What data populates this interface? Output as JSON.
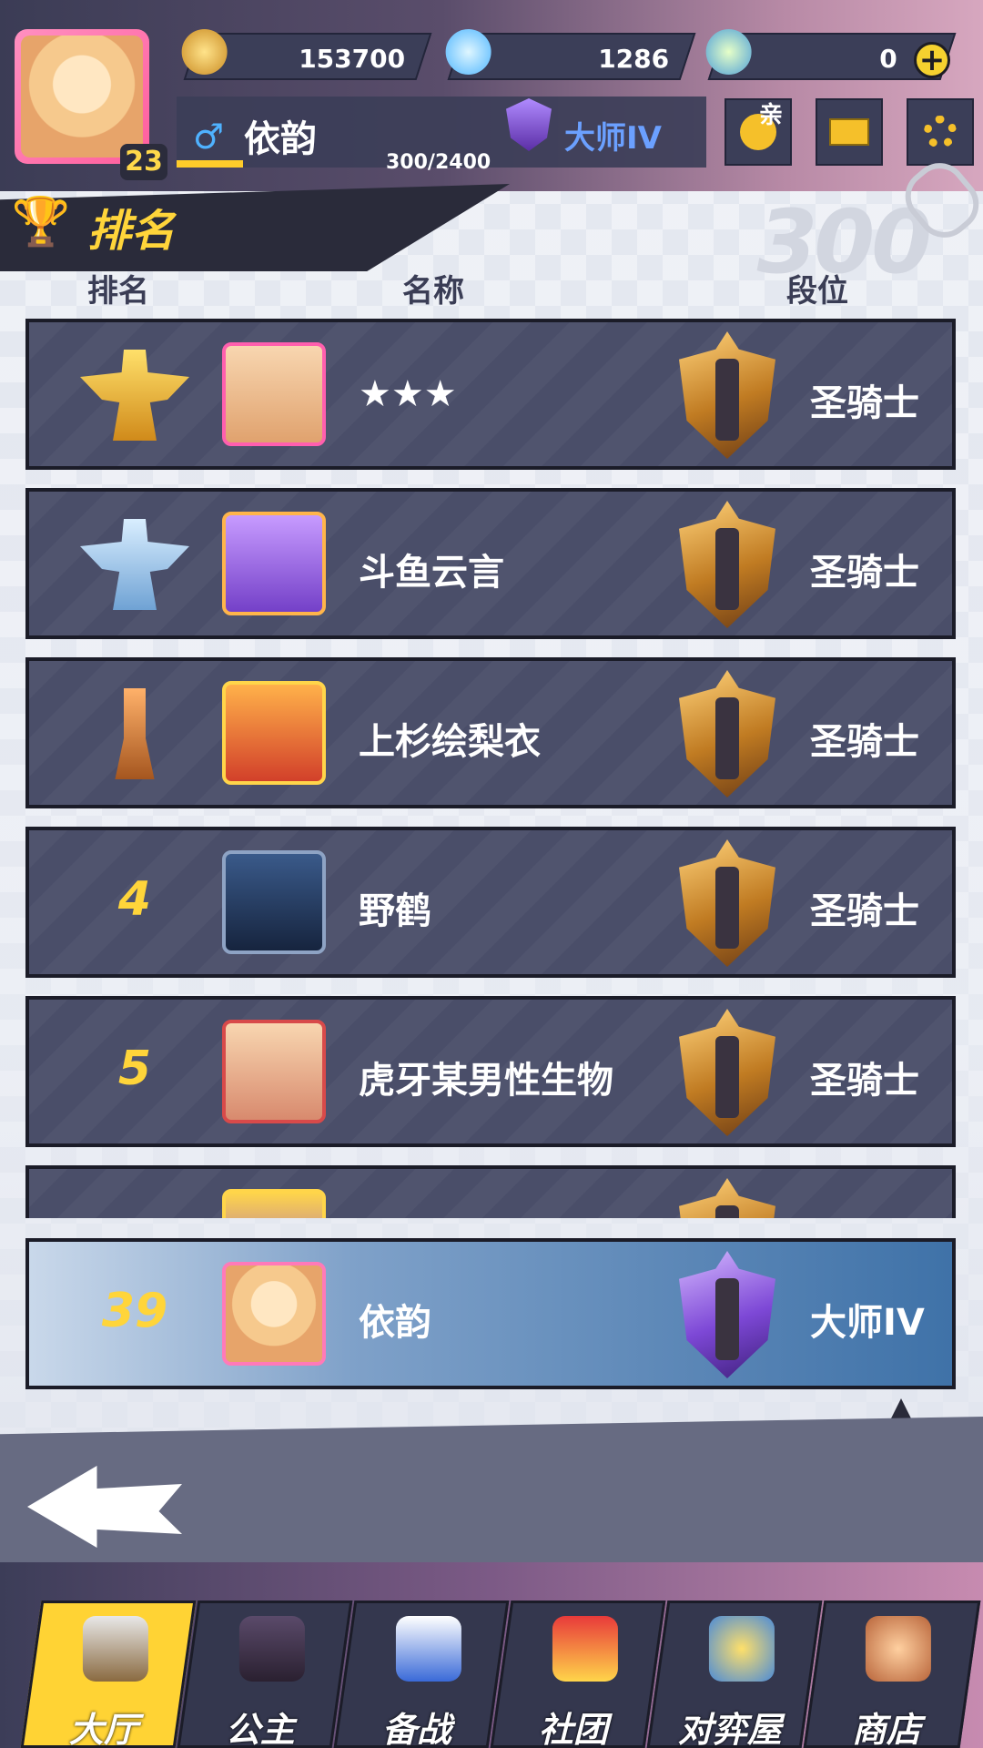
{
  "header": {
    "gold": "153700",
    "diamonds": "1286",
    "tickets": "0",
    "plus_glyph": "+",
    "player_name": "依韵",
    "player_level": "23",
    "player_rank": "大师IV",
    "xp_text": "300/2400",
    "xp_progress": 0.125,
    "gender_glyph": "♂",
    "friend_tag": "亲"
  },
  "panel": {
    "title": "排名",
    "col_rank": "排名",
    "col_name": "名称",
    "col_tier": "段位"
  },
  "rows": [
    {
      "rank": "",
      "medal": "gold",
      "name": "★★★",
      "tier": "圣骑士"
    },
    {
      "rank": "",
      "medal": "silver",
      "name": "斗鱼云言",
      "tier": "圣骑士"
    },
    {
      "rank": "",
      "medal": "bronze",
      "name": "上杉绘梨衣",
      "tier": "圣骑士"
    },
    {
      "rank": "4",
      "medal": "",
      "name": "野鹤",
      "tier": "圣骑士"
    },
    {
      "rank": "5",
      "medal": "",
      "name": "虎牙某男性生物",
      "tier": "圣骑士"
    }
  ],
  "self_row": {
    "rank": "39",
    "name": "依韵",
    "tier": "大师IV"
  },
  "nav": {
    "items": [
      {
        "label": "大厅",
        "icon": "swords-icon",
        "active": true
      },
      {
        "label": "公主",
        "icon": "princess-icon",
        "active": false
      },
      {
        "label": "备战",
        "icon": "chess-pieces-icon",
        "active": false
      },
      {
        "label": "社团",
        "icon": "guild-house-icon",
        "active": false
      },
      {
        "label": "对弈屋",
        "icon": "duel-house-icon",
        "active": false
      },
      {
        "label": "商店",
        "icon": "shop-icon",
        "active": false
      }
    ]
  },
  "colors": {
    "accent_yellow": "#ffd53a",
    "row_bg": "#4a4e69",
    "self_row_blue": "#3f72a8"
  }
}
